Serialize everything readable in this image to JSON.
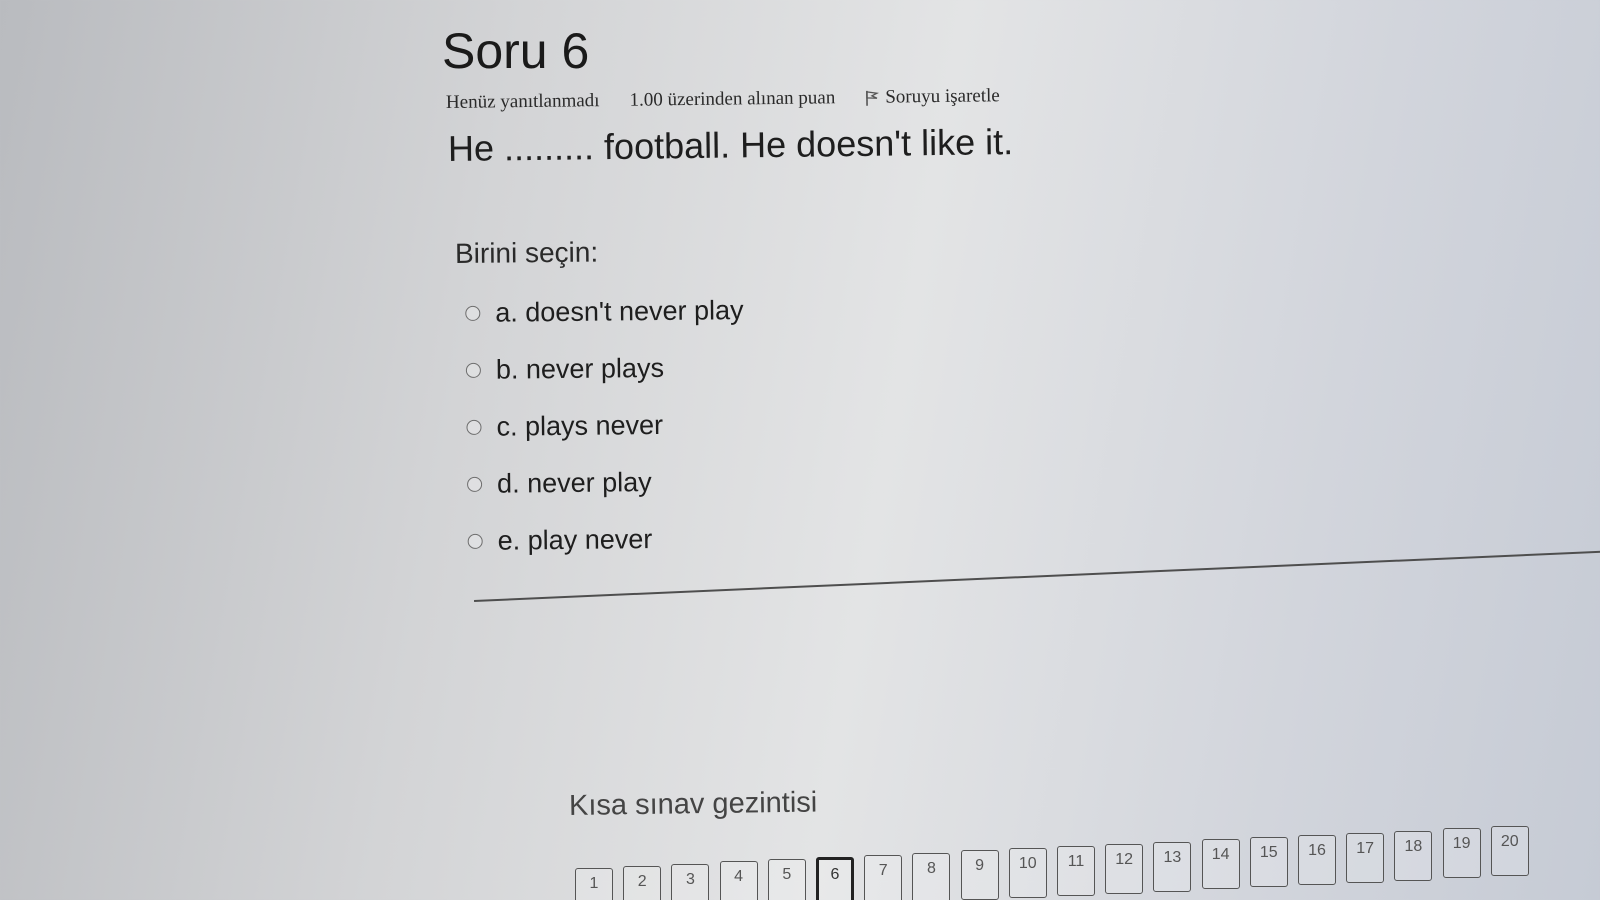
{
  "question": {
    "title": "Soru 6",
    "status": "Henüz yanıtlanmadı",
    "grade": "1.00 üzerinden alınan puan",
    "flag_label": "Soruyu işaretle",
    "text": "He ......... football. He doesn't like it.",
    "prompt": "Birini seçin:",
    "options": [
      "a. doesn't never play",
      "b. never plays",
      "c. plays never",
      "d. never play",
      "e. play never"
    ]
  },
  "navigation": {
    "title": "Kısa sınav gezintisi",
    "buttons": [
      "1",
      "2",
      "3",
      "4",
      "5",
      "6",
      "7",
      "8",
      "9",
      "10",
      "11",
      "12",
      "13",
      "14",
      "15",
      "16",
      "17",
      "18",
      "19",
      "20"
    ],
    "current": "6",
    "answered": [
      "3",
      "4",
      "5"
    ]
  },
  "colors": {
    "answered_marker": "#46506a",
    "text": "#1e1e1e"
  }
}
